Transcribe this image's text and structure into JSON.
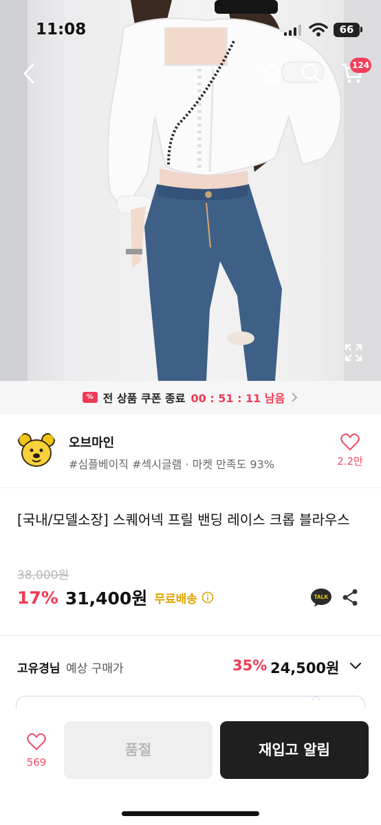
{
  "status_bar": {
    "time": "11:08",
    "battery": "66"
  },
  "header": {
    "cart_count": "124"
  },
  "coupon_banner": {
    "label": "전 상품 쿠폰 종료",
    "timer": "00 : 51 : 11 남음"
  },
  "seller": {
    "name": "오브마인",
    "tags": "#심플베이직 #섹시글램 · 마켓 만족도 93%",
    "likes": "2.2만"
  },
  "product": {
    "title": "[국내/모델소장] 스퀘어넥 프릴 밴딩 레이스 크롭 블라우스",
    "original_price": "38,000원",
    "discount": "17%",
    "price": "31,400원",
    "shipping": "무료배송",
    "talk_label": "TALK"
  },
  "member": {
    "name": "고유경님",
    "label": "예상 구매가",
    "discount": "35%",
    "price": "24,500원"
  },
  "bottom_bar": {
    "wish_count": "569",
    "sold_out": "품절",
    "restock": "재입고 알림"
  },
  "colors": {
    "accent": "#ef3b55",
    "shipping": "#e0a400",
    "dark_button": "#1f1f1f"
  }
}
